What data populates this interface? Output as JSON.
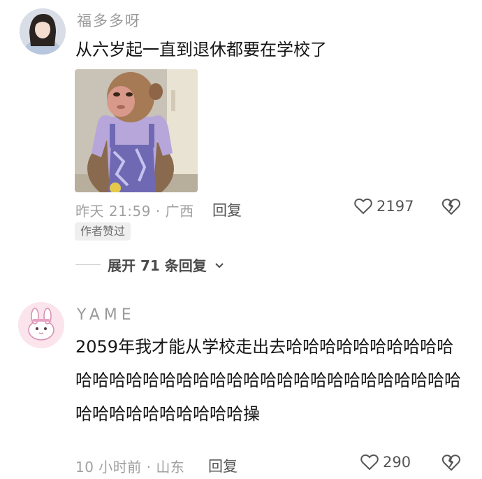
{
  "comments": [
    {
      "username": "福多多呀",
      "text": "从六岁起一直到退休都要在学校了",
      "time_location": "昨天 21:59 · 广西",
      "reply_label": "回复",
      "likes": "2197",
      "badge": "作者赞过",
      "expand_label": "展开 71 条回复"
    },
    {
      "username": "YAME",
      "text": "2059年我才能从学校走出去哈哈哈哈哈哈哈哈哈哈哈哈哈哈哈哈哈哈哈哈哈哈哈哈哈哈哈哈哈哈哈哈哈哈哈哈哈哈哈哈哈哈哈操",
      "time_location": "10 小时前 · 山东",
      "reply_label": "回复",
      "likes": "290"
    }
  ],
  "icons": {
    "like": "heart-outline-icon",
    "dislike": "broken-heart-icon",
    "expand": "chevron-down-icon"
  },
  "colors": {
    "text_primary": "#161616",
    "text_secondary": "#a0a0a0",
    "badge_bg": "#efefef"
  }
}
